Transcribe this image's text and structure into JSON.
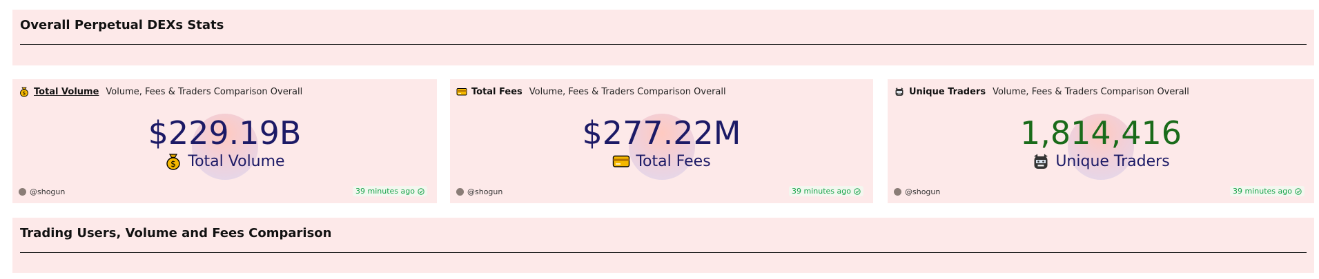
{
  "sections": {
    "top_title": "Overall Perpetual DEXs Stats",
    "bottom_title": "Trading Users, Volume and Fees Comparison"
  },
  "cards": [
    {
      "title": "Total Volume",
      "subtitle": "Volume, Fees & Traders Comparison Overall",
      "value": "$229.19B",
      "label": "Total Volume",
      "icon": "money-bag-icon",
      "author": "@shogun",
      "updated": "39 minutes ago"
    },
    {
      "title": "Total Fees",
      "subtitle": "Volume, Fees & Traders Comparison Overall",
      "value": "$277.22M",
      "label": "Total Fees",
      "icon": "credit-card-icon",
      "author": "@shogun",
      "updated": "39 minutes ago"
    },
    {
      "title": "Unique Traders",
      "subtitle": "Volume, Fees & Traders Comparison Overall",
      "value": "1,814,416",
      "label": "Unique Traders",
      "icon": "robot-face-icon",
      "author": "@shogun",
      "updated": "39 minutes ago"
    }
  ],
  "colors": {
    "panel_bg": "#fde9e9",
    "value_navy": "#1c1a66",
    "value_green": "#1a6b1a",
    "status_green": "#17a34a"
  }
}
